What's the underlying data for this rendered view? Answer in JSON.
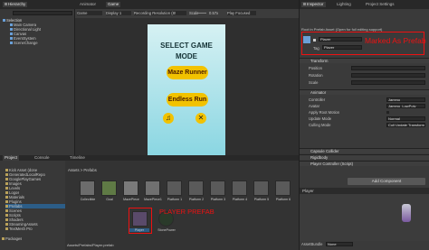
{
  "top_tabs": {
    "hierarchy": "Hierarchy",
    "animator": "Animator",
    "game": "Game",
    "inspector": "Inspector",
    "lighting": "Lighting",
    "project_settings": "Project Settings"
  },
  "game_toolbar": {
    "view": "Game",
    "display": "Display 1",
    "recording": "Recording Resolution (8!",
    "scale_label": "Scale",
    "scale_value": "0.57x",
    "play_focused": "Play Focused"
  },
  "hierarchy": {
    "scene": "Selection",
    "items": [
      "Main Camera",
      "Directional Light",
      "Canvas",
      "EventSystem",
      "SceneChange"
    ]
  },
  "game_view": {
    "title_line1": "SELECT GAME",
    "title_line2": "MODE",
    "maze_button": "Maze Runner",
    "endless_button": "Endless Run"
  },
  "inspector": {
    "prefab_notice": "Root in Prefab Asset (Open for full editing support)",
    "object_name": "Player",
    "tag_label": "Tag",
    "tag_value": "Player",
    "transform": "Transform",
    "position": "Position",
    "rotation": "Rotation",
    "scale": "Scale",
    "animator": "Animator",
    "controller_label": "Controller",
    "controller_value": "Jammo",
    "avatar_label": "Avatar",
    "avatar_value": "Jammo_LowPoly",
    "apply_root_motion": "Apply Root Motion",
    "update_mode": "Update Mode",
    "update_mode_value": "Normal",
    "culling_mode": "Culling Mode",
    "culling_mode_value": "Cull Update Transform",
    "capsule_collider": "Capsule Collider",
    "rigidbody": "Rigidbody",
    "player_controller": "Player Controller (Script)",
    "add_component": "Add Component",
    "preview_name": "Player",
    "asset_bundle_label": "AssetBundle",
    "asset_bundle_value": "None"
  },
  "annotations": {
    "marked": "Marked As Prefab",
    "player_prefab": "PLAYER PREFAB"
  },
  "bottom_tabs": {
    "project": "Project",
    "console": "Console",
    "timeline": "Timeline"
  },
  "project": {
    "tree": [
      "Kick Asset (done",
      "GeneratedLocalRepo",
      "GooglePlayGames",
      "Images",
      "Levels",
      "Logos",
      "Materials",
      "Plugins",
      "Prefabs",
      "Scenes",
      "Scripts",
      "Shaders",
      "StreamingAssets",
      "TextMesh Pro"
    ],
    "packages_label": "Packages",
    "breadcrumb_assets": "Assets",
    "breadcrumb_prefabs": "Prefabs",
    "assets_row1": [
      "Collectible",
      "Goal",
      "MazePiece",
      "MazePiece1",
      "Platform 1",
      "Platform 2",
      "Platform 3",
      "Platform 4",
      "Platform 5",
      "Platform 6"
    ],
    "assets_row2": [
      "Player",
      "StonePower"
    ],
    "path": "Assets/Prefabs/Player.prefab"
  },
  "colors": {
    "game_bg_top": "#d3f0f2",
    "game_bg_bottom": "#7cd1df",
    "button": "#f2c200",
    "annotation": "#e11111"
  }
}
